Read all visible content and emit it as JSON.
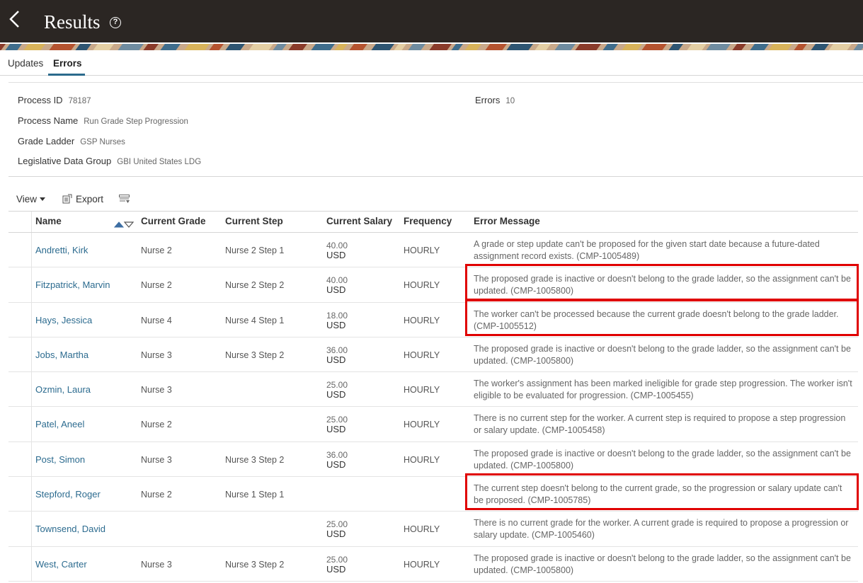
{
  "header": {
    "title": "Results",
    "help": "?"
  },
  "tabs": [
    {
      "label": "Updates"
    },
    {
      "label": "Errors"
    }
  ],
  "summary": {
    "process_id": {
      "label": "Process ID",
      "value": "78187"
    },
    "process_name": {
      "label": "Process Name",
      "value": "Run Grade Step Progression"
    },
    "grade_ladder": {
      "label": "Grade Ladder",
      "value": "GSP Nurses"
    },
    "ldg": {
      "label": "Legislative Data Group",
      "value": "GBI United States LDG"
    },
    "errors": {
      "label": "Errors",
      "value": "10"
    }
  },
  "toolbar": {
    "view_label": "View",
    "export_label": "Export"
  },
  "table": {
    "columns": [
      "Name",
      "Current Grade",
      "Current Step",
      "Current Salary",
      "Frequency",
      "Error Message"
    ],
    "rows": [
      {
        "name": "Andretti, Kirk",
        "grade": "Nurse 2",
        "step": "Nurse 2 Step 1",
        "salary": "40.00",
        "currency": "USD",
        "frequency": "HOURLY",
        "error": "A grade or step update can't be proposed for the given start date because a future-dated assignment record exists. (CMP-1005489)"
      },
      {
        "name": "Fitzpatrick, Marvin",
        "grade": "Nurse 2",
        "step": "Nurse 2 Step 2",
        "salary": "40.00",
        "currency": "USD",
        "frequency": "HOURLY",
        "error": "The proposed grade is inactive or doesn't belong to the grade ladder, so the assignment can't be updated. (CMP-1005800)"
      },
      {
        "name": "Hays, Jessica",
        "grade": "Nurse 4",
        "step": "Nurse 4 Step 1",
        "salary": "18.00",
        "currency": "USD",
        "frequency": "HOURLY",
        "error": "The worker can't be processed because the current grade doesn't belong to the grade ladder. (CMP-1005512)"
      },
      {
        "name": "Jobs, Martha",
        "grade": "Nurse 3",
        "step": "Nurse 3 Step 2",
        "salary": "36.00",
        "currency": "USD",
        "frequency": "HOURLY",
        "error": "The proposed grade is inactive or doesn't belong to the grade ladder, so the assignment can't be updated. (CMP-1005800)"
      },
      {
        "name": "Ozmin, Laura",
        "grade": "Nurse 3",
        "step": "",
        "salary": "25.00",
        "currency": "USD",
        "frequency": "HOURLY",
        "error": "The worker's assignment has been marked ineligible for grade step progression. The worker isn't eligible to be evaluated for progression. (CMP-1005455)"
      },
      {
        "name": "Patel, Aneel",
        "grade": "Nurse 2",
        "step": "",
        "salary": "25.00",
        "currency": "USD",
        "frequency": "HOURLY",
        "error": "There is no current step for the worker. A current step is required to propose a step progression or salary update. (CMP-1005458)"
      },
      {
        "name": "Post, Simon",
        "grade": "Nurse 3",
        "step": "Nurse 3 Step 2",
        "salary": "36.00",
        "currency": "USD",
        "frequency": "HOURLY",
        "error": "The proposed grade is inactive or doesn't belong to the grade ladder, so the assignment can't be updated. (CMP-1005800)"
      },
      {
        "name": "Stepford, Roger",
        "grade": "Nurse 2",
        "step": "Nurse 1 Step 1",
        "salary": "",
        "currency": "",
        "frequency": "",
        "error": "The current step doesn't belong to the current grade, so the progression or salary update can't be proposed. (CMP-1005785)"
      },
      {
        "name": "Townsend, David",
        "grade": "",
        "step": "",
        "salary": "25.00",
        "currency": "USD",
        "frequency": "HOURLY",
        "error": "There is no current grade for the worker. A current grade is required to propose a progression or salary update. (CMP-1005460)"
      },
      {
        "name": "West, Carter",
        "grade": "Nurse 3",
        "step": "Nurse 3 Step 2",
        "salary": "25.00",
        "currency": "USD",
        "frequency": "HOURLY",
        "error": "The proposed grade is inactive or doesn't belong to the grade ladder, so the assignment can't be updated. (CMP-1005800)"
      }
    ]
  },
  "highlighted_rows": [
    1,
    2,
    7
  ],
  "colors": {
    "header_bg": "#2b2623",
    "link": "#2c6b8f",
    "highlight": "#e00000",
    "tab_underline": "#2b6a8c"
  }
}
